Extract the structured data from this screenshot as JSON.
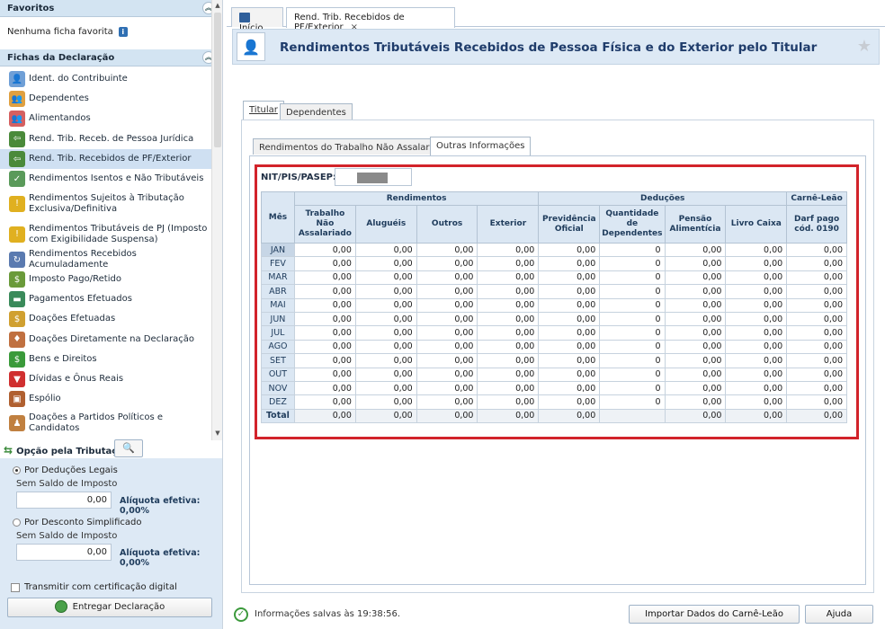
{
  "left": {
    "favoritos": {
      "title": "Favoritos",
      "empty": "Nenhuma ficha favorita"
    },
    "fichas": {
      "title": "Fichas da Declaração",
      "items": [
        {
          "label": "Ident. do Contribuinte",
          "icon": "person-icon",
          "color": "#6f9fd6"
        },
        {
          "label": "Dependentes",
          "icon": "dependents-icon",
          "color": "#e0a040"
        },
        {
          "label": "Alimentandos",
          "icon": "alimentandos-icon",
          "color": "#d56060"
        },
        {
          "label": "Rend. Trib. Receb. de Pessoa Jurídica",
          "icon": "income-pj-icon",
          "color": "#4a8a3a"
        },
        {
          "label": "Rend. Trib. Recebidos de PF/Exterior",
          "icon": "income-pf-icon",
          "color": "#4a8a3a",
          "selected": true
        },
        {
          "label": "Rendimentos Isentos e Não Tributáveis",
          "icon": "exempt-income-icon",
          "color": "#5a9a5a"
        },
        {
          "label": "Rendimentos Sujeitos à Tributação Exclusiva/Definitiva",
          "icon": "warning-income-icon",
          "color": "#e0b020"
        },
        {
          "label": "Rendimentos Tributáveis de PJ (Imposto com Exigibilidade Suspensa)",
          "icon": "suspended-income-icon",
          "color": "#e0b020"
        },
        {
          "label": "Rendimentos Recebidos Acumuladamente",
          "icon": "accumulated-income-icon",
          "color": "#5a7ab0"
        },
        {
          "label": "Imposto Pago/Retido",
          "icon": "tax-paid-icon",
          "color": "#6a9a3a"
        },
        {
          "label": "Pagamentos Efetuados",
          "icon": "payments-icon",
          "color": "#3a8a5a"
        },
        {
          "label": "Doações Efetuadas",
          "icon": "donations-icon",
          "color": "#d0a030"
        },
        {
          "label": "Doações Diretamente na Declaração",
          "icon": "direct-donations-icon",
          "color": "#c07040"
        },
        {
          "label": "Bens e Direitos",
          "icon": "assets-icon",
          "color": "#3a9a3a"
        },
        {
          "label": "Dívidas e Ônus Reais",
          "icon": "debts-icon",
          "color": "#d03030"
        },
        {
          "label": "Espólio",
          "icon": "estate-icon",
          "color": "#b06030"
        },
        {
          "label": "Doações a Partidos Políticos e Candidatos",
          "icon": "political-donations-icon",
          "color": "#c08040"
        }
      ]
    },
    "opcao": {
      "title": "Opção pela Tributação:",
      "deducoes_label": "Por Deduções Legais",
      "deducoes_sub": "Sem Saldo de Imposto",
      "deducoes_value": "0,00",
      "deducoes_aliq": "Alíquota efetiva: 0,00%",
      "simplificado_label": "Por Desconto Simplificado",
      "simplificado_sub": "Sem Saldo de Imposto",
      "simplificado_value": "0,00",
      "simplificado_aliq": "Alíquota efetiva: 0,00%",
      "cert_label": "Transmitir com certificação digital",
      "entregar_label": "Entregar Declaração"
    }
  },
  "tabs": [
    {
      "label": "Início"
    },
    {
      "label": "Rend. Trib. Recebidos de PF/Exterior",
      "close": "×"
    }
  ],
  "header": {
    "title": "Rendimentos Tributáveis Recebidos de Pessoa Física e do Exterior pelo Titular"
  },
  "subtabs": [
    {
      "label": "Titular"
    },
    {
      "label": "Dependentes"
    }
  ],
  "innertabs": [
    {
      "label": "Rendimentos do Trabalho Não Assalariado"
    },
    {
      "label": "Outras Informações"
    }
  ],
  "nit": {
    "label": "NIT/PIS/PASEP:"
  },
  "grid": {
    "group_headers": {
      "rendimentos": "Rendimentos",
      "deducoes": "Deduções",
      "carne": "Carnê-Leão"
    },
    "mes_header": "Mês",
    "columns": [
      "Trabalho Não Assalariado",
      "Aluguéis",
      "Outros",
      "Exterior",
      "Previdência Oficial",
      "Quantidade de Dependentes",
      "Pensão Alimentícia",
      "Livro Caixa",
      "Darf pago cód. 0190"
    ],
    "rows": [
      {
        "mes": "JAN",
        "v": [
          "0,00",
          "0,00",
          "0,00",
          "0,00",
          "0,00",
          "0",
          "0,00",
          "0,00",
          "0,00"
        ]
      },
      {
        "mes": "FEV",
        "v": [
          "0,00",
          "0,00",
          "0,00",
          "0,00",
          "0,00",
          "0",
          "0,00",
          "0,00",
          "0,00"
        ]
      },
      {
        "mes": "MAR",
        "v": [
          "0,00",
          "0,00",
          "0,00",
          "0,00",
          "0,00",
          "0",
          "0,00",
          "0,00",
          "0,00"
        ]
      },
      {
        "mes": "ABR",
        "v": [
          "0,00",
          "0,00",
          "0,00",
          "0,00",
          "0,00",
          "0",
          "0,00",
          "0,00",
          "0,00"
        ]
      },
      {
        "mes": "MAI",
        "v": [
          "0,00",
          "0,00",
          "0,00",
          "0,00",
          "0,00",
          "0",
          "0,00",
          "0,00",
          "0,00"
        ]
      },
      {
        "mes": "JUN",
        "v": [
          "0,00",
          "0,00",
          "0,00",
          "0,00",
          "0,00",
          "0",
          "0,00",
          "0,00",
          "0,00"
        ]
      },
      {
        "mes": "JUL",
        "v": [
          "0,00",
          "0,00",
          "0,00",
          "0,00",
          "0,00",
          "0",
          "0,00",
          "0,00",
          "0,00"
        ]
      },
      {
        "mes": "AGO",
        "v": [
          "0,00",
          "0,00",
          "0,00",
          "0,00",
          "0,00",
          "0",
          "0,00",
          "0,00",
          "0,00"
        ]
      },
      {
        "mes": "SET",
        "v": [
          "0,00",
          "0,00",
          "0,00",
          "0,00",
          "0,00",
          "0",
          "0,00",
          "0,00",
          "0,00"
        ]
      },
      {
        "mes": "OUT",
        "v": [
          "0,00",
          "0,00",
          "0,00",
          "0,00",
          "0,00",
          "0",
          "0,00",
          "0,00",
          "0,00"
        ]
      },
      {
        "mes": "NOV",
        "v": [
          "0,00",
          "0,00",
          "0,00",
          "0,00",
          "0,00",
          "0",
          "0,00",
          "0,00",
          "0,00"
        ]
      },
      {
        "mes": "DEZ",
        "v": [
          "0,00",
          "0,00",
          "0,00",
          "0,00",
          "0,00",
          "0",
          "0,00",
          "0,00",
          "0,00"
        ]
      }
    ],
    "total": {
      "mes": "Total",
      "v": [
        "0,00",
        "0,00",
        "0,00",
        "0,00",
        "0,00",
        "",
        "0,00",
        "0,00",
        "0,00"
      ]
    }
  },
  "status": {
    "saved_text": "Informações salvas às 19:38:56.",
    "import_label": "Importar Dados do Carnê-Leão",
    "help_label": "Ajuda"
  }
}
